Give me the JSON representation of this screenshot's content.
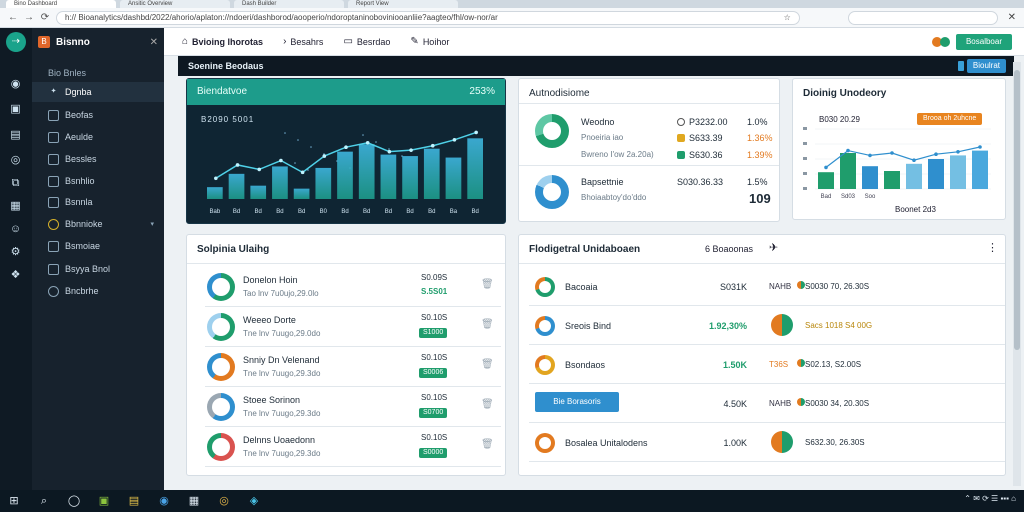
{
  "browser": {
    "tabs": [
      "Bino Dashboard",
      "Ansitic Overview",
      "Dash Builder",
      "Report View"
    ],
    "url": "h:// Bioanalytics/dashbd/2022/ahorio/aplaton://ndoeri/dashborod/aooperio/ndoroptaninoboviniooanliie?aagteo/fhl/ow-nor/ar",
    "star": "☆",
    "back": "←",
    "forward": "→",
    "reload": "⟳",
    "close": "✕"
  },
  "rail": {
    "logo": "⇢",
    "icons": [
      "◉",
      "▣",
      "▤",
      "◎",
      "⧉",
      "▦",
      "☺",
      "⚙",
      "❖"
    ]
  },
  "sidebar": {
    "title": "Bisnno",
    "badge": "B",
    "collapse": "✕",
    "section": "Bio Bnles",
    "items": [
      {
        "label": "Dgnba",
        "icon": "✦"
      },
      {
        "label": "Beofas",
        "icon": "▢"
      },
      {
        "label": "Aeulde",
        "icon": "▢"
      },
      {
        "label": "Bessles",
        "icon": "▢"
      },
      {
        "label": "Bsnhlio",
        "icon": "▢"
      },
      {
        "label": "Bsnnla",
        "icon": "▢"
      },
      {
        "label": "Bbnnioke",
        "icon": "◯"
      },
      {
        "label": "Bsmoiae",
        "icon": "▢"
      },
      {
        "label": "Bsyya Bnol",
        "icon": "▢"
      },
      {
        "label": "Bncbrhe",
        "icon": "◯"
      }
    ],
    "chevron": "▾"
  },
  "topbar": {
    "breadcrumbs": [
      "Bvioing lhorotas",
      "Besahrs",
      "Besrdao",
      "Hoihor"
    ],
    "action_label": "Bosalboar"
  },
  "banner": {
    "title": "Soenine Beodaus",
    "action_label": "Bioulrat"
  },
  "cards": {
    "trend": {
      "title": "Biendatvoe",
      "value": "253%",
      "overlay_label": "B2090 5001"
    },
    "analytics": {
      "title": "Autnodisiome",
      "rows": [
        {
          "name": "Weodno",
          "sub1": "Pnoeiria iao",
          "sub2": "Bwreno I'ow 2a.20a)",
          "v1": "P3232.00",
          "v1b": "1.0%",
          "v2": "S633.39",
          "v2b": "1.36%",
          "v3": "S630.36",
          "v3b": "1.39%"
        },
        {
          "name": "Bapsettnie",
          "sub": "Bhoiaabtoy'do'ddo",
          "value": "S030.36.33",
          "pct": "1.5%",
          "big": "109"
        }
      ]
    },
    "delivery": {
      "title": "Dioinig Unodeory",
      "value_label": "B030 20.29",
      "pill_label": "Brooa oh 2uhcne",
      "axis_title": "Boonet 2d3",
      "ticks": [
        "Bad",
        "Sd03",
        "Soo"
      ]
    },
    "ranking": {
      "title": "Solpinia Ulaihg",
      "rows": [
        {
          "name": "Donelon Hoin",
          "sub": "Tao lnv 7u0ujo,29.0lo",
          "amount": "S0.09S",
          "pct": "S.5S01"
        },
        {
          "name": "Weeeo Dorte",
          "sub": "Tne lnv 7uugo,29.0do",
          "amount": "S0.10S",
          "pct": "S1000"
        },
        {
          "name": "Snniy Dn Velenand",
          "sub": "Tne lnv 7uugo,29.3do",
          "amount": "S0.10S",
          "pct": "S0006"
        },
        {
          "name": "Stoee Sorinon",
          "sub": "Tne lnv 7uugo,29.3do",
          "amount": "S0.10S",
          "pct": "S0700"
        },
        {
          "name": "Delnns Uoaedonn",
          "sub": "Tne lnv 7uugo,29.3do",
          "amount": "S0.10S",
          "pct": "S0000"
        }
      ]
    },
    "performance": {
      "title": "Flodigetral Unidaboaen",
      "count_label": "6 Boaoonas",
      "rows": [
        {
          "name": "Bacoaia",
          "val": "S031K",
          "tag": "NAHB",
          "tail": "S0030 70, 26.30S"
        },
        {
          "name": "Sreois Bind",
          "val": "1.92,30%",
          "tag": "",
          "tail": "Sacs 1018 S4 00G"
        },
        {
          "name": "Bsondaos",
          "val": "1.50K",
          "tag": "T36S",
          "tail": "S02.13, S2.00S"
        },
        {
          "name": "Bie Borasoris",
          "val": "4.50K",
          "tag": "NAHB",
          "tail": "S0030 34, 20.30S",
          "button": true
        },
        {
          "name": "Bosalea Unitalodens",
          "val": "1.00K",
          "tag": "",
          "tail": "S632.30, 26.30S"
        }
      ]
    }
  },
  "taskbar": {
    "icons": [
      "⊞",
      "⌕",
      "◯",
      "▣",
      "▤",
      "◉",
      "▦",
      "◎",
      "◈"
    ],
    "tray": "⌃  ✉  ⟳  ☰  ▪▪▪  ⌂"
  },
  "colors": {
    "teal": "#1d9c8b",
    "green": "#1f9d6c",
    "blue": "#2f8fce",
    "orange": "#e27a20",
    "dark": "#0e1822"
  },
  "chart_data": [
    {
      "type": "bar",
      "categories": [
        "Bab",
        "Bd",
        "Bd",
        "Bd",
        "Bd",
        "B0",
        "Bd",
        "Bd",
        "Bd",
        "Bd",
        "Bd",
        "Ba",
        "Bd"
      ],
      "values": [
        16,
        34,
        18,
        44,
        14,
        42,
        64,
        74,
        60,
        58,
        68,
        56,
        82
      ],
      "series": [
        {
          "values": [
            28,
            46,
            40,
            52,
            36,
            58,
            70,
            76,
            64,
            66,
            72,
            80,
            90
          ]
        }
      ],
      "ylim": [
        0,
        100
      ]
    },
    {
      "type": "bar",
      "categories": [
        "Bad",
        "Sd03",
        "Soo",
        "",
        "",
        "",
        "",
        ""
      ],
      "values": [
        28,
        60,
        38,
        30,
        42,
        50,
        56,
        64
      ],
      "series": [
        {
          "values": [
            36,
            64,
            56,
            60,
            48,
            58,
            62,
            70
          ]
        }
      ],
      "ylim": [
        0,
        100
      ]
    }
  ]
}
